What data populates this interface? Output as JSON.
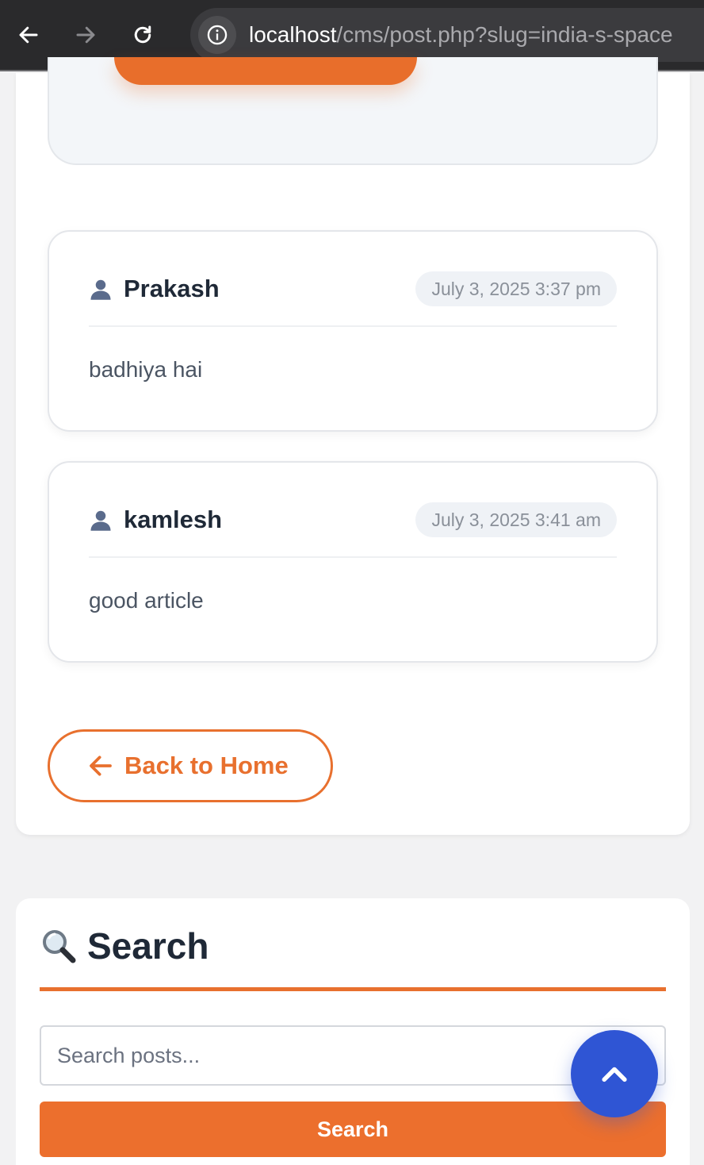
{
  "browser": {
    "url_host": "localhost",
    "url_path": "/cms/post.php?slug=india-s-space"
  },
  "comments": [
    {
      "author": "Prakash",
      "date": "July 3, 2025 3:37 pm",
      "body": "badhiya hai"
    },
    {
      "author": "kamlesh",
      "date": "July 3, 2025 3:41 am",
      "body": "good article"
    }
  ],
  "back_button": {
    "label": "Back to Home"
  },
  "search": {
    "title": "Search",
    "placeholder": "Search posts...",
    "button_label": "Search"
  },
  "colors": {
    "accent": "#e8702e",
    "scroll_button": "#2f55d4",
    "heading": "#1f2937"
  },
  "icons": {
    "back": "arrow-left-icon",
    "forward": "arrow-right-icon",
    "reload": "reload-icon",
    "info": "info-icon",
    "user": "user-icon",
    "search": "magnifier-icon",
    "scroll_top": "chevron-up-icon"
  }
}
